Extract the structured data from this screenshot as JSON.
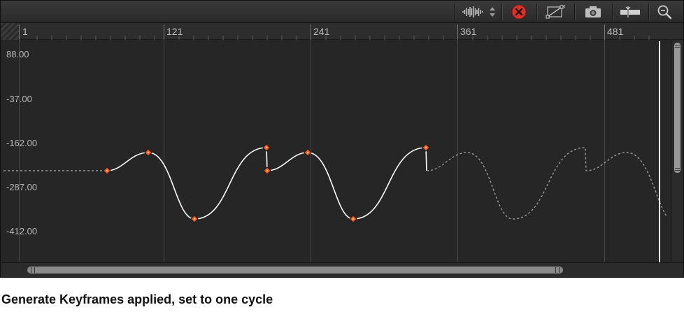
{
  "toolbar": {
    "icons": [
      "audio-waveform-icon",
      "stepper-icon",
      "clear-curves-icon",
      "curve-edit-icon",
      "snapshot-camera-icon",
      "fit-frame-icon",
      "zoom-icon"
    ],
    "clear_color": "#d9322a"
  },
  "ruler": {
    "labels": [
      "1",
      "121",
      "241",
      "361",
      "481"
    ]
  },
  "graph": {
    "y_labels": [
      "88.00",
      "-37.00",
      "-162.00",
      "-287.00",
      "-412.00"
    ],
    "keyframe_color": "#e0612c",
    "curve_color": "#ffffff",
    "extrapolation_color": "#9a9a9a"
  },
  "caption": "Generate Keyframes applied, set to one cycle"
}
